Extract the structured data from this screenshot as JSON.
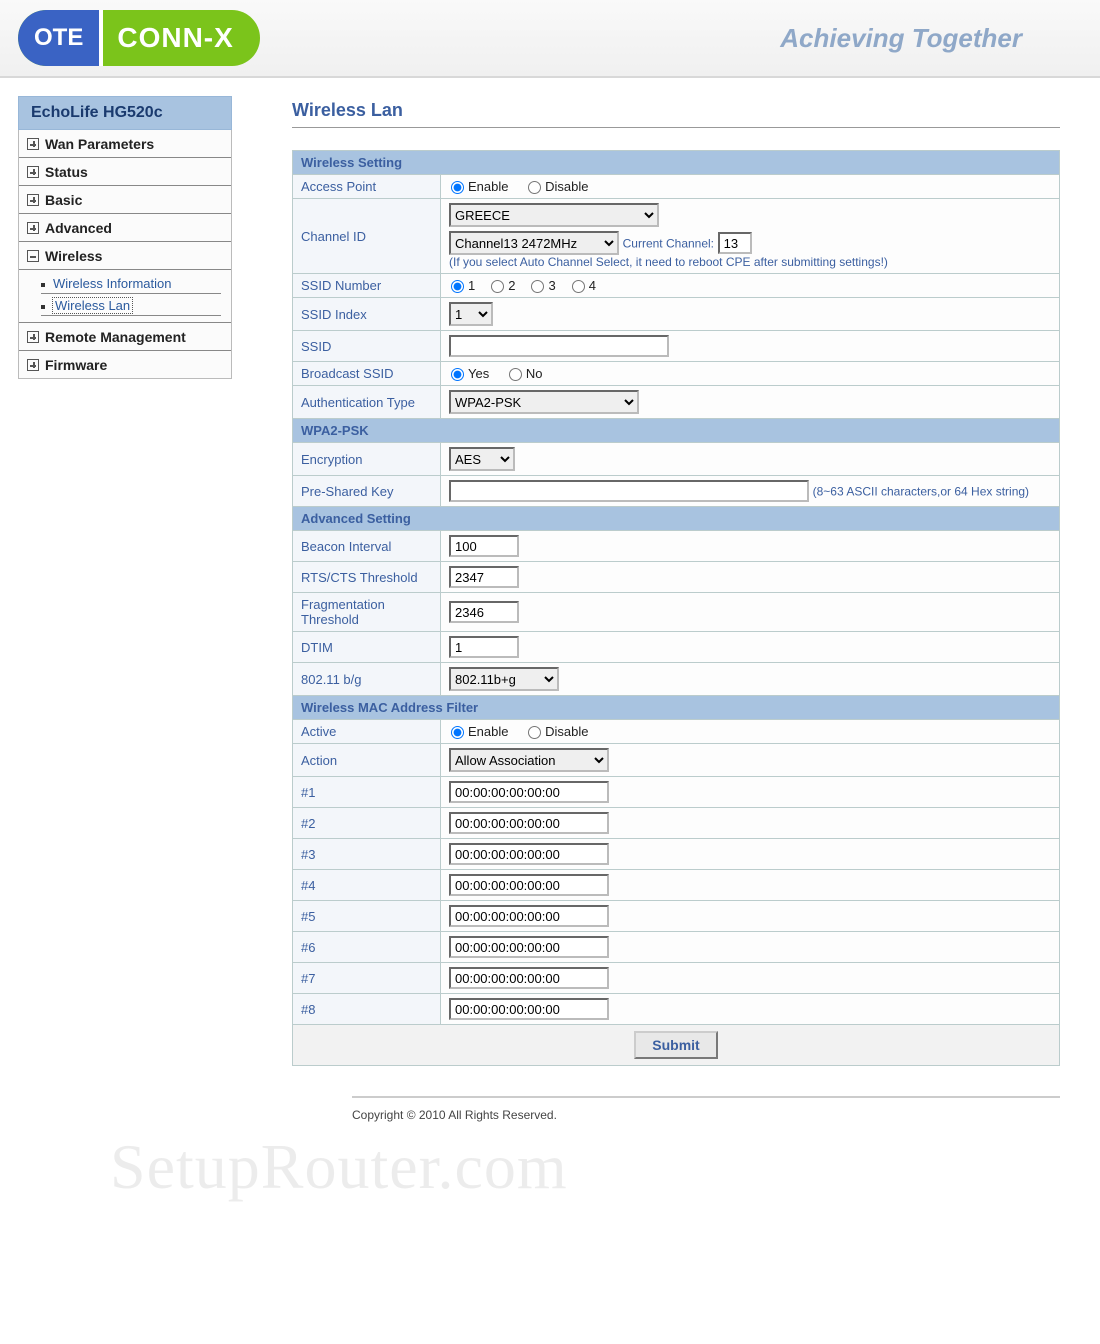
{
  "header": {
    "logo_l": "OTE",
    "logo_r": "CONN-X",
    "tagline": "Achieving Together"
  },
  "sidebar": {
    "title": "EchoLife HG520c",
    "items": [
      {
        "label": "Wan Parameters",
        "expanded": false
      },
      {
        "label": "Status",
        "expanded": false
      },
      {
        "label": "Basic",
        "expanded": false
      },
      {
        "label": "Advanced",
        "expanded": false
      },
      {
        "label": "Wireless",
        "expanded": true,
        "children": [
          {
            "label": "Wireless Information",
            "active": false
          },
          {
            "label": "Wireless Lan",
            "active": true
          }
        ]
      },
      {
        "label": "Remote Management",
        "expanded": false
      },
      {
        "label": "Firmware",
        "expanded": false
      }
    ]
  },
  "page": {
    "title": "Wireless Lan"
  },
  "sections": {
    "wireless_setting": {
      "header": "Wireless Setting",
      "access_point": {
        "label": "Access Point",
        "enable": "Enable",
        "disable": "Disable",
        "value": "Enable"
      },
      "channel_id": {
        "label": "Channel ID",
        "country": "GREECE",
        "channel": "Channel13 2472MHz",
        "current_label": "Current Channel:",
        "current_value": "13",
        "note": "(If you select Auto Channel Select, it need to reboot CPE after submitting settings!)"
      },
      "ssid_number": {
        "label": "SSID Number",
        "options": [
          "1",
          "2",
          "3",
          "4"
        ],
        "value": "1"
      },
      "ssid_index": {
        "label": "SSID Index",
        "value": "1"
      },
      "ssid": {
        "label": "SSID",
        "value": ""
      },
      "broadcast": {
        "label": "Broadcast SSID",
        "yes": "Yes",
        "no": "No",
        "value": "Yes"
      },
      "auth_type": {
        "label": "Authentication Type",
        "value": "WPA2-PSK"
      }
    },
    "wpa2": {
      "header": "WPA2-PSK",
      "encryption": {
        "label": "Encryption",
        "value": "AES"
      },
      "psk": {
        "label": "Pre-Shared Key",
        "value": "",
        "hint": "(8~63 ASCII characters,or 64 Hex string)"
      }
    },
    "advanced": {
      "header": "Advanced Setting",
      "beacon": {
        "label": "Beacon Interval",
        "value": "100"
      },
      "rts": {
        "label": "RTS/CTS Threshold",
        "value": "2347"
      },
      "frag": {
        "label": "Fragmentation Threshold",
        "value": "2346"
      },
      "dtim": {
        "label": "DTIM",
        "value": "1"
      },
      "mode": {
        "label": "802.11 b/g",
        "value": "802.11b+g"
      }
    },
    "mac_filter": {
      "header": "Wireless MAC Address Filter",
      "active": {
        "label": "Active",
        "enable": "Enable",
        "disable": "Disable",
        "value": "Enable"
      },
      "action": {
        "label": "Action",
        "value": "Allow Association"
      },
      "rows": [
        {
          "idx": "#1",
          "mac": "00:00:00:00:00:00"
        },
        {
          "idx": "#2",
          "mac": "00:00:00:00:00:00"
        },
        {
          "idx": "#3",
          "mac": "00:00:00:00:00:00"
        },
        {
          "idx": "#4",
          "mac": "00:00:00:00:00:00"
        },
        {
          "idx": "#5",
          "mac": "00:00:00:00:00:00"
        },
        {
          "idx": "#6",
          "mac": "00:00:00:00:00:00"
        },
        {
          "idx": "#7",
          "mac": "00:00:00:00:00:00"
        },
        {
          "idx": "#8",
          "mac": "00:00:00:00:00:00"
        }
      ]
    }
  },
  "submit_label": "Submit",
  "footer": "Copyright © 2010 All Rights Reserved.",
  "watermark": "SetupRouter.com"
}
